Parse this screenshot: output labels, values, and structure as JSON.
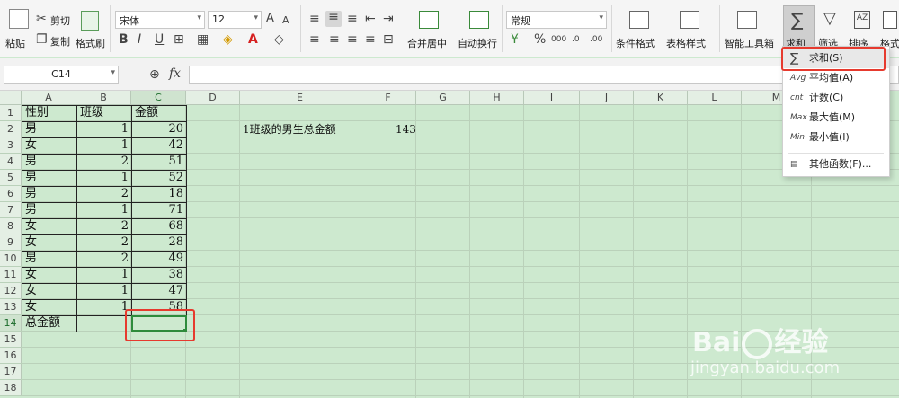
{
  "ribbon": {
    "paste": "粘贴",
    "cut": "剪切",
    "copy": "复制",
    "format_painter": "格式刷",
    "font_name": "宋体",
    "font_size": "12",
    "merge_center": "合并居中",
    "auto_wrap": "自动换行",
    "number_format": "常规",
    "conditional_format": "条件格式",
    "table_style": "表格样式",
    "smart_toolbox": "智能工具箱",
    "sum": "求和",
    "filter": "筛选",
    "sort": "排序",
    "format": "格式"
  },
  "formula_bar": {
    "name_box": "C14",
    "fx": "fx"
  },
  "columns": [
    "A",
    "B",
    "C",
    "D",
    "E",
    "F",
    "G",
    "H",
    "I",
    "J",
    "K",
    "L",
    "M"
  ],
  "rows": [
    "1",
    "2",
    "3",
    "4",
    "5",
    "6",
    "7",
    "8",
    "9",
    "10",
    "11",
    "12",
    "13",
    "14",
    "15",
    "16",
    "17",
    "18"
  ],
  "table": {
    "headers": [
      "性别",
      "班级",
      "金额"
    ],
    "data": [
      [
        "男",
        "1",
        "20"
      ],
      [
        "女",
        "1",
        "42"
      ],
      [
        "男",
        "2",
        "51"
      ],
      [
        "男",
        "1",
        "52"
      ],
      [
        "男",
        "2",
        "18"
      ],
      [
        "男",
        "1",
        "71"
      ],
      [
        "女",
        "2",
        "68"
      ],
      [
        "女",
        "2",
        "28"
      ],
      [
        "男",
        "2",
        "49"
      ],
      [
        "女",
        "1",
        "38"
      ],
      [
        "女",
        "1",
        "47"
      ],
      [
        "女",
        "1",
        "58"
      ]
    ],
    "total_label": "总金额"
  },
  "side": {
    "label": "1班级的男生总金额",
    "value": "143"
  },
  "dropdown": [
    {
      "icon": "∑",
      "label": "求和(S)"
    },
    {
      "icon": "Avg",
      "label": "平均值(A)"
    },
    {
      "icon": "cnt",
      "label": "计数(C)"
    },
    {
      "icon": "Max",
      "label": "最大值(M)"
    },
    {
      "icon": "Min",
      "label": "最小值(I)"
    },
    {
      "icon": "▤",
      "label": "其他函数(F)..."
    }
  ],
  "watermark": {
    "brand": "Bai",
    "brand2": "经验",
    "url": "jingyan.baidu.com"
  },
  "colors": {
    "accent_red": "#e63a2e",
    "grid_bg": "#cde9cf",
    "selection_green": "#2e8b3c"
  }
}
